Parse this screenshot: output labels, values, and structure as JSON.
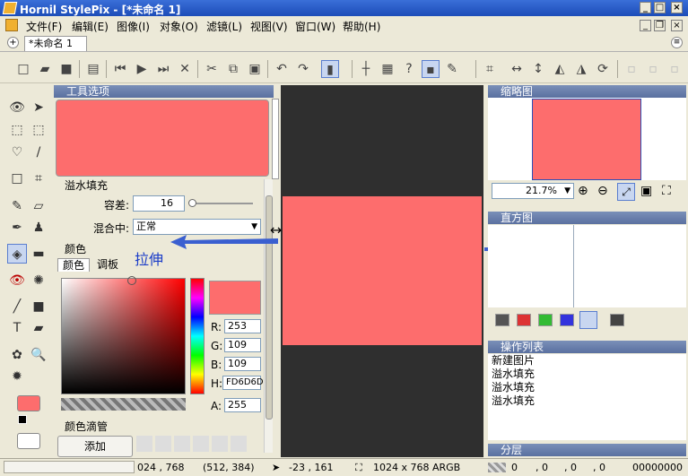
{
  "window": {
    "title": "Hornil StylePix - [*未命名 1]"
  },
  "menu": [
    "文件(F)",
    "编辑(E)",
    "图像(I)",
    "对象(O)",
    "滤镜(L)",
    "视图(V)",
    "窗口(W)",
    "帮助(H)"
  ],
  "tab": {
    "label": "*未命名 1"
  },
  "tool_options": {
    "header": "工具选项",
    "section": "溢水填充",
    "tolerance_label": "容差:",
    "tolerance_value": "16",
    "blend_label": "混合中:",
    "blend_value": "正常",
    "preview_color": "#fd6d6d"
  },
  "color_panel": {
    "header": "颜色",
    "tab1": "颜色",
    "tab2": "调板",
    "r_label": "R:",
    "r_value": "253",
    "g_label": "G:",
    "g_value": "109",
    "b_label": "B:",
    "b_value": "109",
    "h_label": "H:",
    "h_value": "FD6D6D",
    "a_label": "A:",
    "a_value": "255",
    "swatch": "#fd6d6d"
  },
  "picker_panel": {
    "header": "颜色滴管",
    "add_label": "添加"
  },
  "annotations": {
    "left": "拉伸",
    "right": "拉伸"
  },
  "thumbnail": {
    "header": "缩略图",
    "zoom": "21.7%"
  },
  "histogram": {
    "header": "直方图"
  },
  "history": {
    "header": "操作列表",
    "items": [
      "新建图片",
      "溢水填充",
      "溢水填充",
      "溢水填充"
    ]
  },
  "layers": {
    "header": "分层"
  },
  "status": {
    "size": "024 , 768",
    "pos": "(512, 384)",
    "cursor": "-23 , 161",
    "info": "1024 x 768 ARGB",
    "c1": "0",
    "c2": ", 0",
    "c3": ", 0",
    "c4": ", 0",
    "hex": "00000000"
  },
  "colors": {
    "image": "#fd6d6d",
    "canvas_bg": "#2f2f2f",
    "arrow": "#3a5fd0"
  }
}
